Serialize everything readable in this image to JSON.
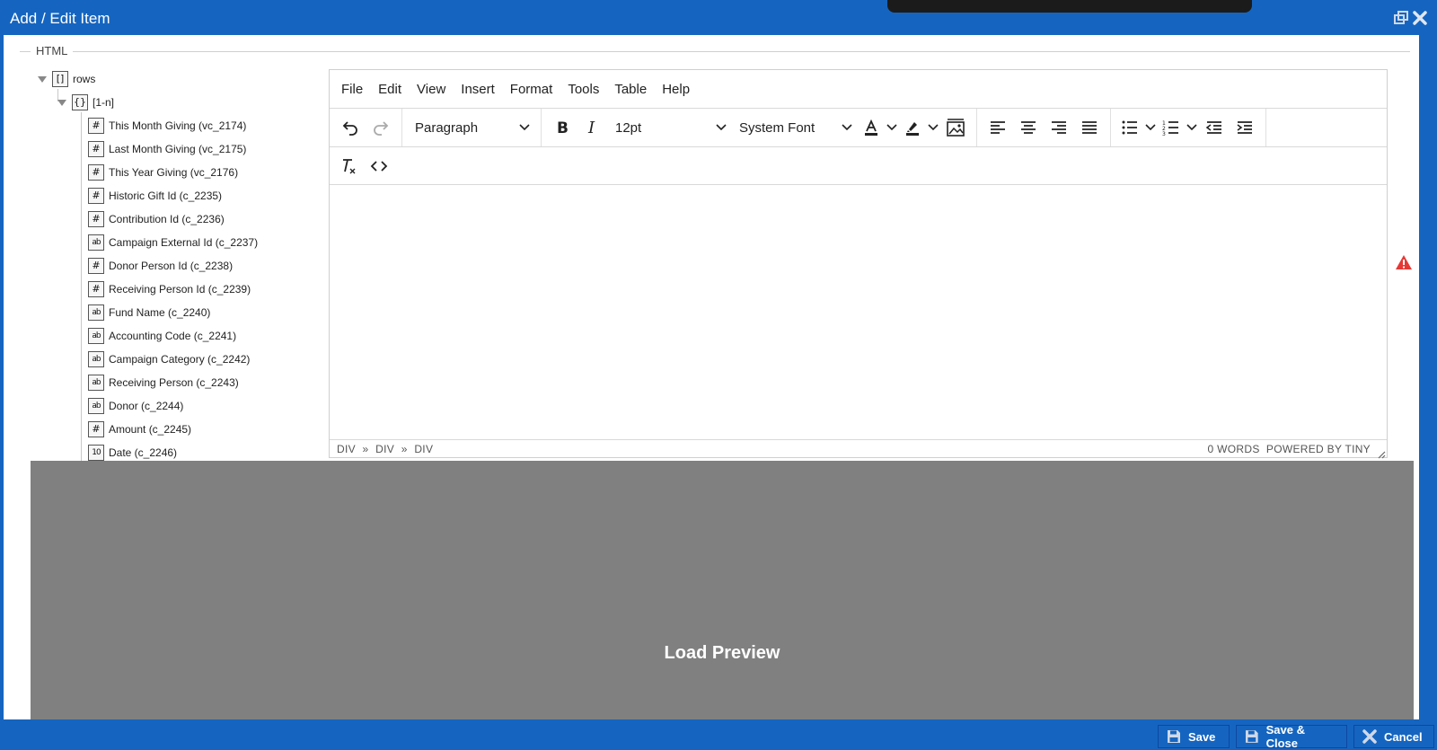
{
  "window": {
    "title": "Add / Edit Item"
  },
  "section": {
    "legend": "HTML"
  },
  "tree": {
    "root": {
      "label": "rows",
      "icon": "[]"
    },
    "group": {
      "label": "[1-n]",
      "icon": "{}"
    },
    "fields": [
      {
        "label": "This Month Giving (vc_2174)",
        "type": "#"
      },
      {
        "label": "Last Month Giving (vc_2175)",
        "type": "#"
      },
      {
        "label": "This Year Giving (vc_2176)",
        "type": "#"
      },
      {
        "label": "Historic Gift Id (c_2235)",
        "type": "#"
      },
      {
        "label": "Contribution Id (c_2236)",
        "type": "#"
      },
      {
        "label": "Campaign External Id (c_2237)",
        "type": "ab"
      },
      {
        "label": "Donor Person Id (c_2238)",
        "type": "#"
      },
      {
        "label": "Receiving Person Id (c_2239)",
        "type": "#"
      },
      {
        "label": "Fund Name (c_2240)",
        "type": "ab"
      },
      {
        "label": "Accounting Code (c_2241)",
        "type": "ab"
      },
      {
        "label": "Campaign Category (c_2242)",
        "type": "ab"
      },
      {
        "label": "Receiving Person (c_2243)",
        "type": "ab"
      },
      {
        "label": "Donor (c_2244)",
        "type": "ab"
      },
      {
        "label": "Amount (c_2245)",
        "type": "#"
      },
      {
        "label": "Date (c_2246)",
        "type": "10"
      }
    ]
  },
  "editor": {
    "menu": [
      "File",
      "Edit",
      "View",
      "Insert",
      "Format",
      "Tools",
      "Table",
      "Help"
    ],
    "block_format": "Paragraph",
    "font_size": "12pt",
    "font_family": "System Font",
    "status_path": [
      "DIV",
      "»",
      "DIV",
      "»",
      "DIV"
    ],
    "word_count": "0 WORDS",
    "powered_by": "POWERED BY TINY"
  },
  "preview": {
    "label": "Load Preview"
  },
  "footer": {
    "save": "Save",
    "save_close": "Save & Close",
    "cancel": "Cancel"
  },
  "colors": {
    "brand": "#1565c0",
    "preview_bg": "#808080",
    "warning": "#e53935"
  }
}
